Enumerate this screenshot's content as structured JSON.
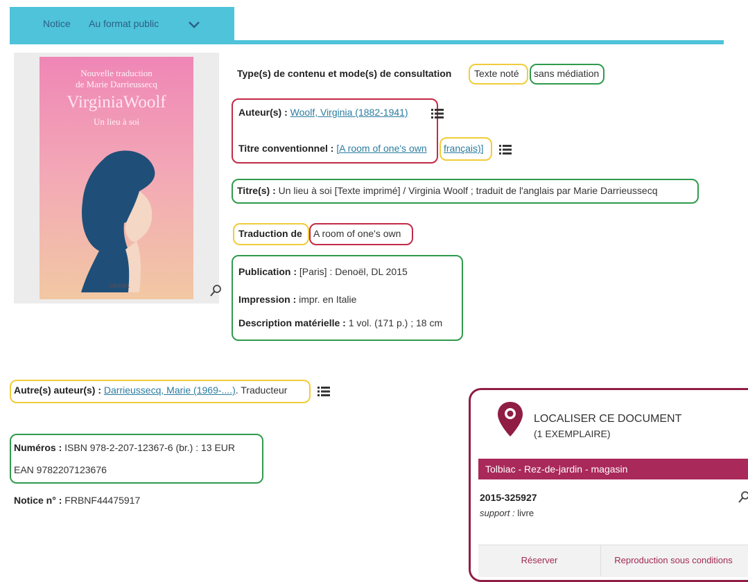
{
  "tabs": {
    "notice": "Notice",
    "format": "Au format public"
  },
  "cover": {
    "line1": "Nouvelle traduction",
    "line2": "de Marie Darrieussecq",
    "author": "VirginiaWoolf",
    "title": "Un lieu à soi",
    "publisher": "DENOËL"
  },
  "record": {
    "type_label": "Type(s) de contenu et mode(s) de consultation",
    "type_value1": "Texte noté",
    "type_value2": "sans médiation",
    "author_label": "Auteur(s) :",
    "author_value": "Woolf, Virginia (1882-1941)",
    "uniform_title_label": "Titre conventionnel :",
    "uniform_title_value": "[A room of one's own",
    "uniform_title_lang": "français)]",
    "title_label": "Titre(s) :",
    "title_value": "Un lieu à soi [Texte imprimé] / Virginia Woolf ; traduit de l'anglais par Marie Darrieussecq",
    "translation_label": "Traduction de",
    "translation_value": "A room of one's own",
    "publication_label": "Publication :",
    "publication_value": "[Paris] : Denoël, DL 2015",
    "printing_label": "Impression :",
    "printing_value": "impr. en Italie",
    "description_label": "Description matérielle :",
    "description_value": "1 vol. (171 p.) ; 18 cm",
    "other_authors_label": "Autre(s) auteur(s) :",
    "other_authors_link": "Darrieussecq, Marie (1969-....)",
    "other_authors_role": ". Traducteur",
    "numbers_label": "Numéros :",
    "isbn_value": "ISBN 978-2-207-12367-6 (br.) : 13 EUR",
    "ean_value": "EAN 9782207123676",
    "notice_label": "Notice n° :",
    "notice_value": "FRBNF44475917"
  },
  "locate": {
    "title": "LOCALISER CE DOCUMENT",
    "count": "(1 EXEMPLAIRE)",
    "location": "Tolbiac - Rez-de-jardin - magasin",
    "shelfmark": "2015-325927",
    "support_label": "support :",
    "support_value": "livre",
    "reserve_button": "Réserver",
    "reproduction_button": "Reproduction sous conditions"
  },
  "colors": {
    "tab_blue": "#4fc3d9",
    "link": "#2b7c9f",
    "highlight_yellow": "#f0cc3a",
    "highlight_red": "#c22a46",
    "highlight_green": "#2f9a4c",
    "locate_crimson": "#a9295a"
  }
}
